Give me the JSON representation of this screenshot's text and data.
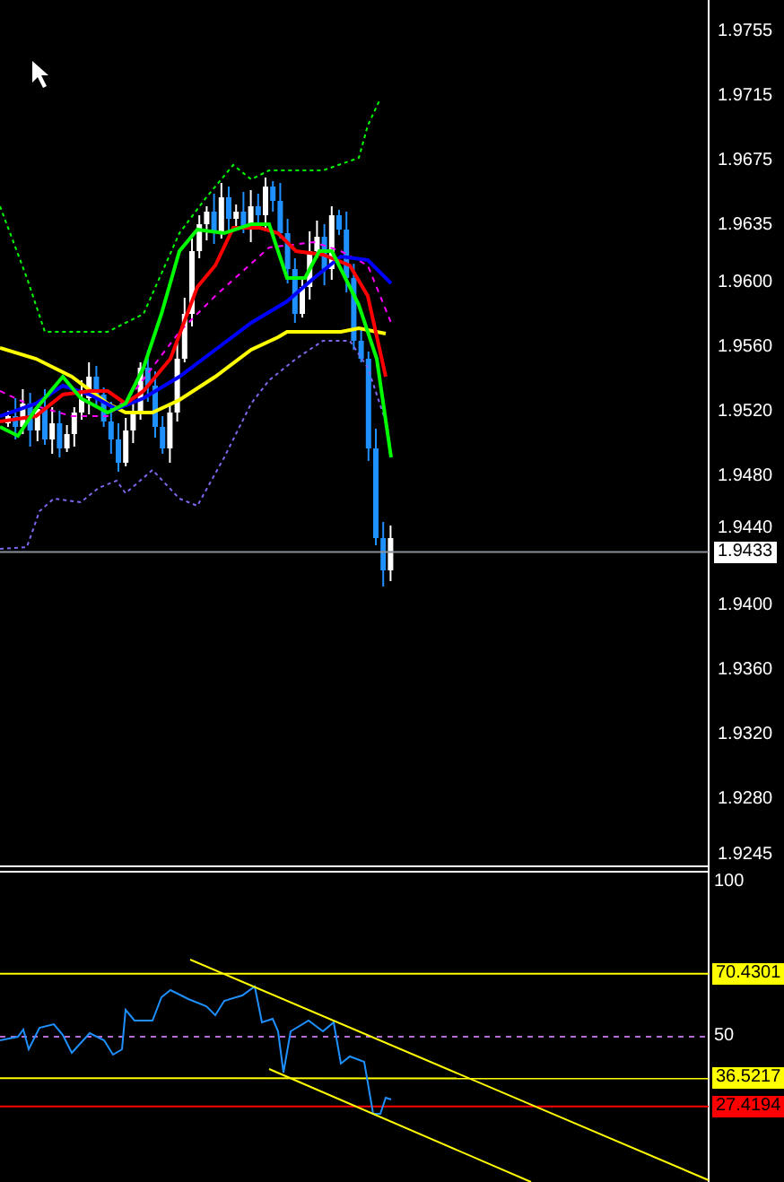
{
  "price_axis": {
    "ticks": [
      "1.9755",
      "1.9715",
      "1.9675",
      "1.9635",
      "1.9600",
      "1.9560",
      "1.9520",
      "1.9480",
      "1.9440",
      "1.9400",
      "1.9360",
      "1.9320",
      "1.9280",
      "1.9245"
    ],
    "current_price": "1.9433"
  },
  "indicator_axis": {
    "ticks": [
      "100",
      "50"
    ],
    "levels": [
      {
        "label": "70.4301",
        "color": "#ffff00"
      },
      {
        "label": "36.5217",
        "color": "#ffff00"
      },
      {
        "label": "27.4194",
        "color": "#ff0000"
      }
    ]
  }
}
